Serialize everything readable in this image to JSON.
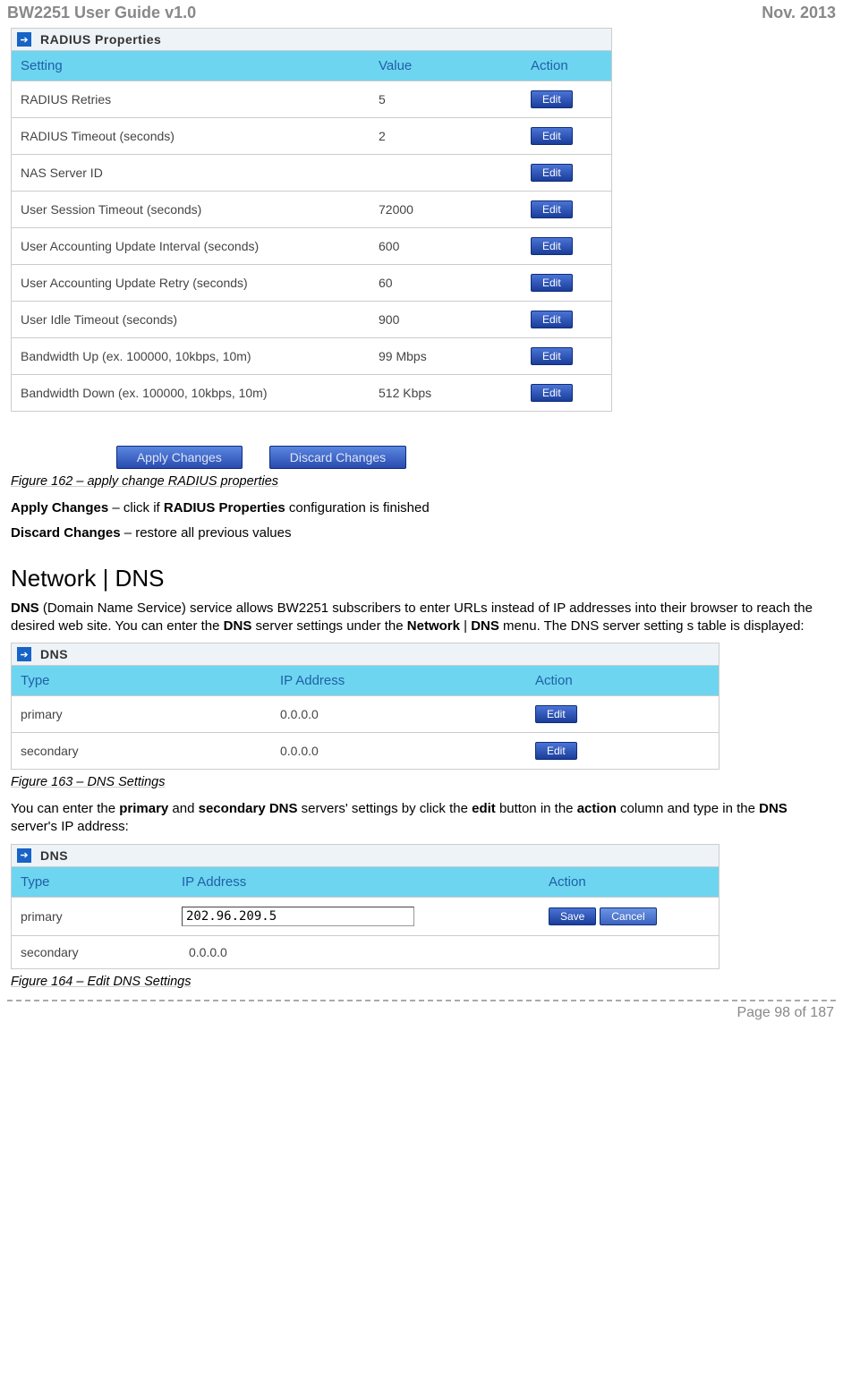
{
  "header": {
    "left": "BW2251 User Guide v1.0",
    "right": "Nov.  2013"
  },
  "radius_panel": {
    "title": "RADIUS Properties",
    "columns": {
      "setting": "Setting",
      "value": "Value",
      "action": "Action"
    },
    "editLabel": "Edit",
    "rows": [
      {
        "setting": "RADIUS Retries",
        "value": "5"
      },
      {
        "setting": "RADIUS Timeout (seconds)",
        "value": "2"
      },
      {
        "setting": "NAS Server ID",
        "value": ""
      },
      {
        "setting": "User Session Timeout (seconds)",
        "value": "72000"
      },
      {
        "setting": "User Accounting Update Interval (seconds)",
        "value": "600"
      },
      {
        "setting": "User Accounting Update Retry (seconds)",
        "value": "60"
      },
      {
        "setting": "User Idle Timeout (seconds)",
        "value": "900"
      },
      {
        "setting": "Bandwidth Up (ex. 100000, 10kbps, 10m)",
        "value": "99 Mbps"
      },
      {
        "setting": "Bandwidth Down (ex. 100000, 10kbps, 10m)",
        "value": "512 Kbps"
      }
    ]
  },
  "buttons": {
    "apply": "Apply Changes",
    "discard": "Discard Changes"
  },
  "fig162": "Figure 162 – apply change RADIUS properties",
  "txt_apply_pre": "Apply Changes",
  "txt_apply_mid": " – click if ",
  "txt_apply_bold2": "RADIUS Properties",
  "txt_apply_post": " configuration is finished",
  "txt_discard_pre": "Discard Changes",
  "txt_discard_post": " – restore all previous values",
  "section_heading": "Network | DNS",
  "dns_intro": {
    "p1a": "DNS",
    "p1b": " (Domain Name Service) service allows BW2251 subscribers to enter URLs instead of IP addresses into their browser to reach the desired web site. You can enter the ",
    "p1c": "DNS",
    "p1d": " server settings under the ",
    "p1e": "Network",
    "p1f": " | ",
    "p1g": "DNS",
    "p1h": " menu. The DNS server setting s table is displayed:"
  },
  "dns_panel": {
    "title": "DNS",
    "columns": {
      "type": "Type",
      "ip": "IP Address",
      "action": "Action"
    },
    "editLabel": "Edit",
    "rows": [
      {
        "type": "primary",
        "ip": "0.0.0.0"
      },
      {
        "type": "secondary",
        "ip": "0.0.0.0"
      }
    ]
  },
  "fig163": "Figure 163 – DNS Settings",
  "dns_mid": {
    "a": "You can enter the ",
    "b": "primary",
    "c": " and ",
    "d": "secondary DNS",
    "e": " servers' settings by click the ",
    "f": "edit",
    "g": " button in the ",
    "h": "action",
    "i": " column and type in the ",
    "j": "DNS",
    "k": " server's IP address:"
  },
  "dns_edit_panel": {
    "title": "DNS",
    "columns": {
      "type": "Type",
      "ip": "IP Address",
      "action": "Action"
    },
    "saveLabel": "Save",
    "cancelLabel": "Cancel",
    "rows": [
      {
        "type": "primary",
        "ip_value": "202.96.209.5"
      },
      {
        "type": "secondary",
        "ip": "0.0.0.0"
      }
    ]
  },
  "fig164": "Figure 164 – Edit DNS Settings",
  "footer": "Page 98 of 187"
}
